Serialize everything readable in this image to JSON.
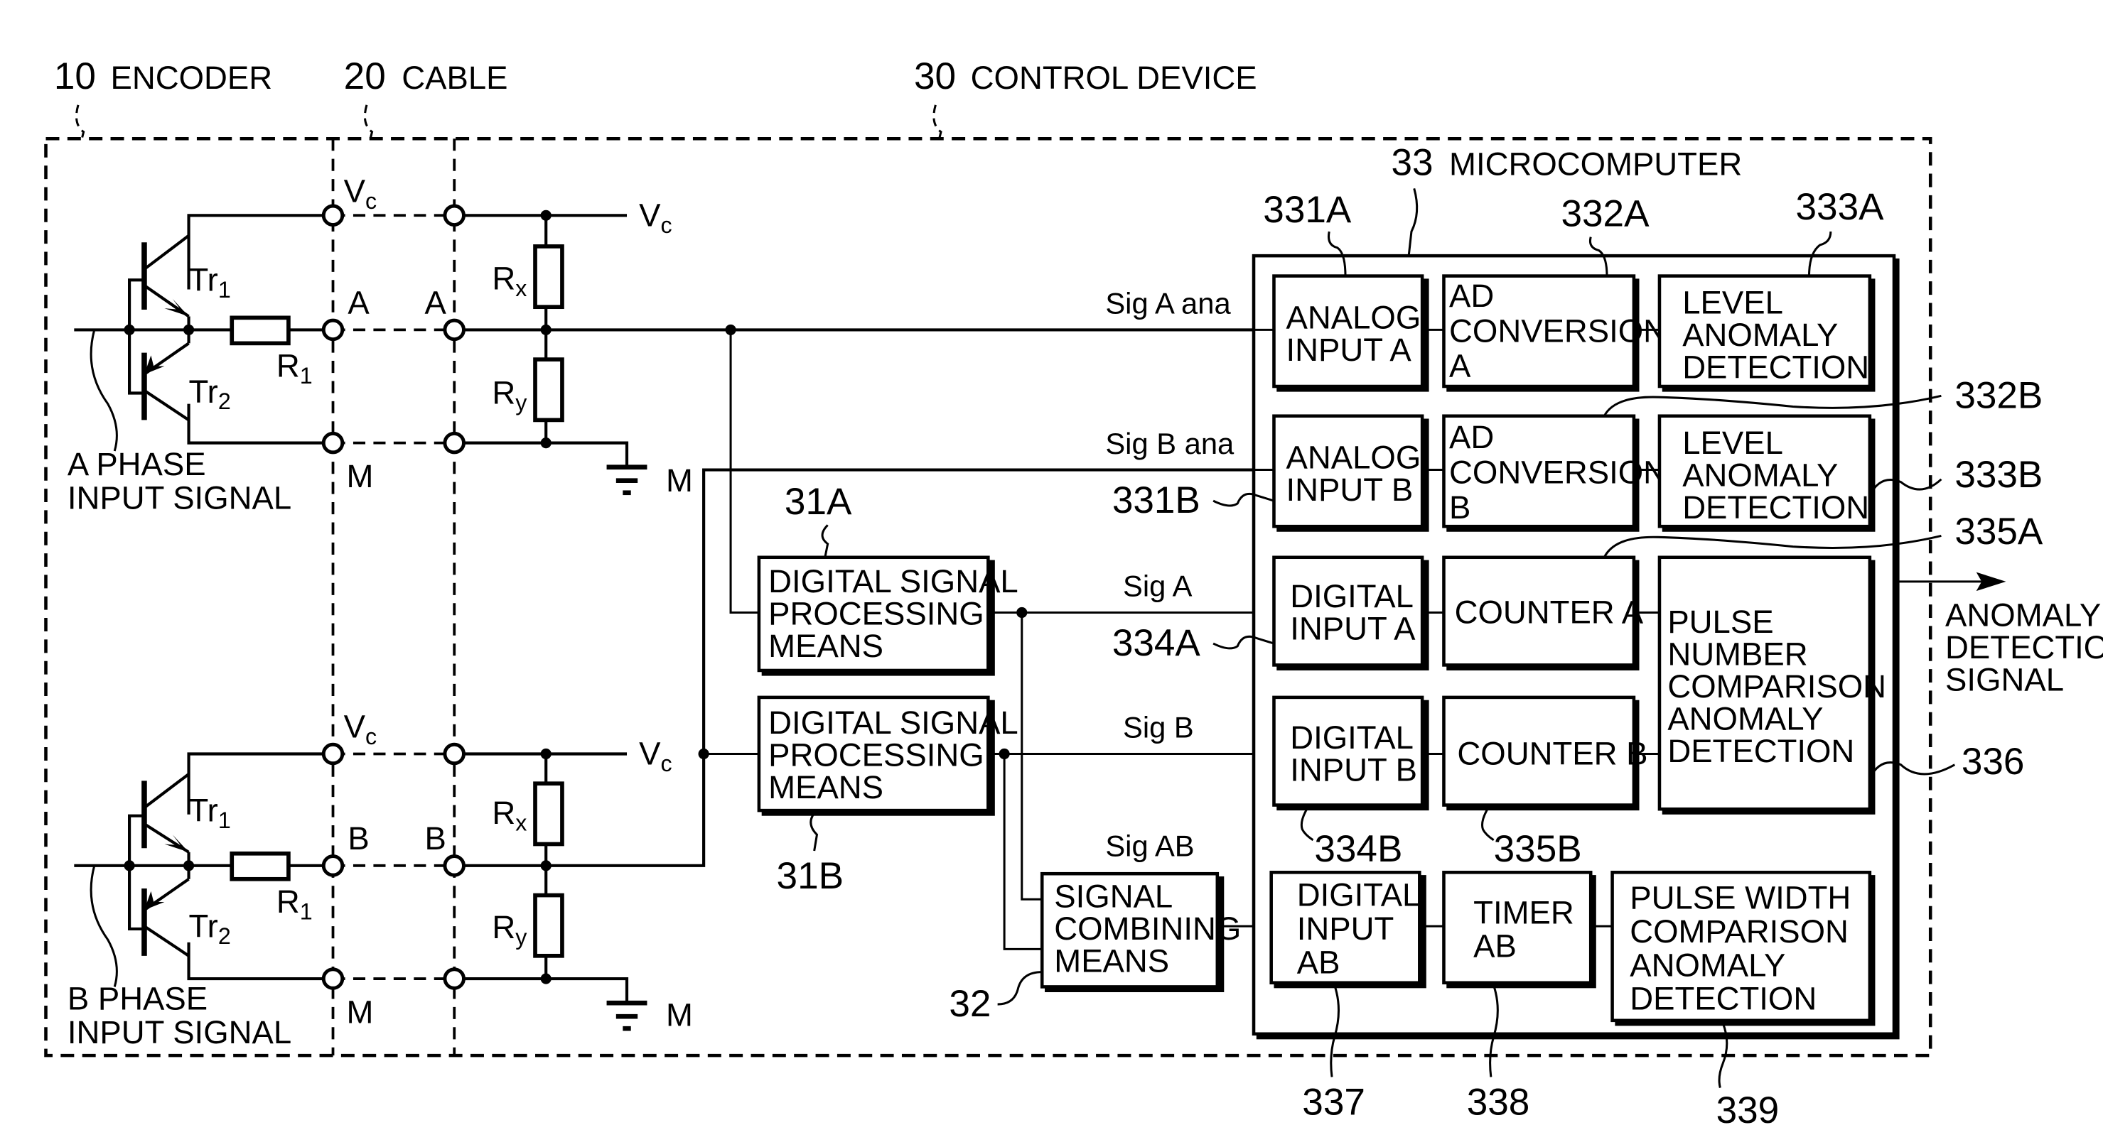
{
  "sections": {
    "encoder": {
      "ref": "10",
      "label": "ENCODER"
    },
    "cable": {
      "ref": "20",
      "label": "CABLE"
    },
    "control_device": {
      "ref": "30",
      "label": "CONTROL DEVICE"
    },
    "microcomputer": {
      "ref": "33",
      "label": "MICROCOMPUTER"
    }
  },
  "encoder_circuit": {
    "a_phase_label": [
      "A PHASE",
      "INPUT SIGNAL"
    ],
    "b_phase_label": [
      "B PHASE",
      "INPUT SIGNAL"
    ],
    "tr1": {
      "main": "Tr",
      "sub": "1"
    },
    "tr2": {
      "main": "Tr",
      "sub": "2"
    },
    "r1": {
      "main": "R",
      "sub": "1"
    },
    "rx": {
      "main": "R",
      "sub": "x"
    },
    "ry": {
      "main": "R",
      "sub": "y"
    },
    "vc": {
      "main": "V",
      "sub": "c"
    },
    "terminal_a": "A",
    "terminal_b": "B",
    "terminal_m": "M",
    "ground_m": "M"
  },
  "signals": {
    "sig_a_ana": "Sig A ana",
    "sig_b_ana": "Sig B ana",
    "sig_a": "Sig A",
    "sig_b": "Sig B",
    "sig_ab": "Sig AB"
  },
  "blocks": {
    "dsp_a": {
      "ref": "31A",
      "lines": [
        "DIGITAL SIGNAL",
        "PROCESSING",
        "MEANS"
      ]
    },
    "dsp_b": {
      "ref": "31B",
      "lines": [
        "DIGITAL SIGNAL",
        "PROCESSING",
        "MEANS"
      ]
    },
    "combiner": {
      "ref": "32",
      "lines": [
        "SIGNAL",
        "COMBINING",
        "MEANS"
      ]
    },
    "analog_input_a": {
      "ref": "331A",
      "lines": [
        "ANALOG",
        "INPUT A"
      ]
    },
    "analog_input_b": {
      "ref": "331B",
      "lines": [
        "ANALOG",
        "INPUT B"
      ]
    },
    "ad_conv_a": {
      "ref": "332A",
      "lines": [
        "AD",
        "CONVERSION",
        "A"
      ]
    },
    "ad_conv_b": {
      "ref": "332B",
      "lines": [
        "AD",
        "CONVERSION",
        "B"
      ]
    },
    "level_anom_a": {
      "ref": "333A",
      "lines": [
        "LEVEL",
        "ANOMALY",
        "DETECTION"
      ]
    },
    "level_anom_b": {
      "ref": "333B",
      "lines": [
        "LEVEL",
        "ANOMALY",
        "DETECTION"
      ]
    },
    "digital_input_a": {
      "ref": "334A",
      "lines": [
        "DIGITAL",
        "INPUT A"
      ]
    },
    "digital_input_b": {
      "ref": "334B",
      "lines": [
        "DIGITAL",
        "INPUT B"
      ]
    },
    "counter_a": {
      "ref": "335A",
      "lines": [
        "COUNTER A"
      ]
    },
    "counter_b": {
      "ref": "335B",
      "lines": [
        "COUNTER B"
      ]
    },
    "pulse_number": {
      "ref": "336",
      "lines": [
        "PULSE",
        "NUMBER",
        "COMPARISON",
        "ANOMALY",
        "DETECTION"
      ]
    },
    "digital_input_ab": {
      "ref": "337",
      "lines": [
        "DIGITAL",
        "INPUT",
        "AB"
      ]
    },
    "timer_ab": {
      "ref": "338",
      "lines": [
        "TIMER",
        "AB"
      ]
    },
    "pulse_width": {
      "ref": "339",
      "lines": [
        "PULSE WIDTH",
        "COMPARISON",
        "ANOMALY",
        "DETECTION"
      ]
    }
  },
  "output": {
    "lines": [
      "ANOMALY",
      "DETECTION",
      "SIGNAL"
    ]
  }
}
